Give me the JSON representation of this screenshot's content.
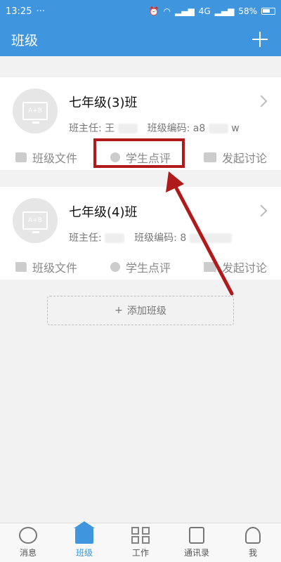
{
  "status_bar": {
    "time": "13:25",
    "dots": "···",
    "network": "4G",
    "battery": "58%"
  },
  "header": {
    "title": "班级",
    "add_icon": "plus-icon"
  },
  "classes": [
    {
      "name": "七年级(3)班",
      "teacher_label": "班主任:",
      "teacher_value": "王",
      "code_label": "班级编码:",
      "code_value": "a8",
      "code_suffix": "w",
      "actions": [
        "班级文件",
        "学生点评",
        "发起讨论"
      ]
    },
    {
      "name": "七年级(4)班",
      "teacher_label": "班主任:",
      "teacher_value": "",
      "code_label": "班级编码:",
      "code_value": "8",
      "code_suffix": "",
      "actions": [
        "班级文件",
        "学生点评",
        "发起讨论"
      ]
    }
  ],
  "add_class": {
    "label": "添加班级",
    "icon": "plus-icon"
  },
  "bottom_nav": [
    {
      "label": "消息",
      "icon": "message-icon"
    },
    {
      "label": "班级",
      "icon": "home-icon",
      "active": true
    },
    {
      "label": "工作",
      "icon": "grid-icon"
    },
    {
      "label": "通讯录",
      "icon": "contacts-icon"
    },
    {
      "label": "我",
      "icon": "person-icon"
    }
  ],
  "colors": {
    "primary": "#3f96df",
    "highlight": "#b11a1a"
  }
}
